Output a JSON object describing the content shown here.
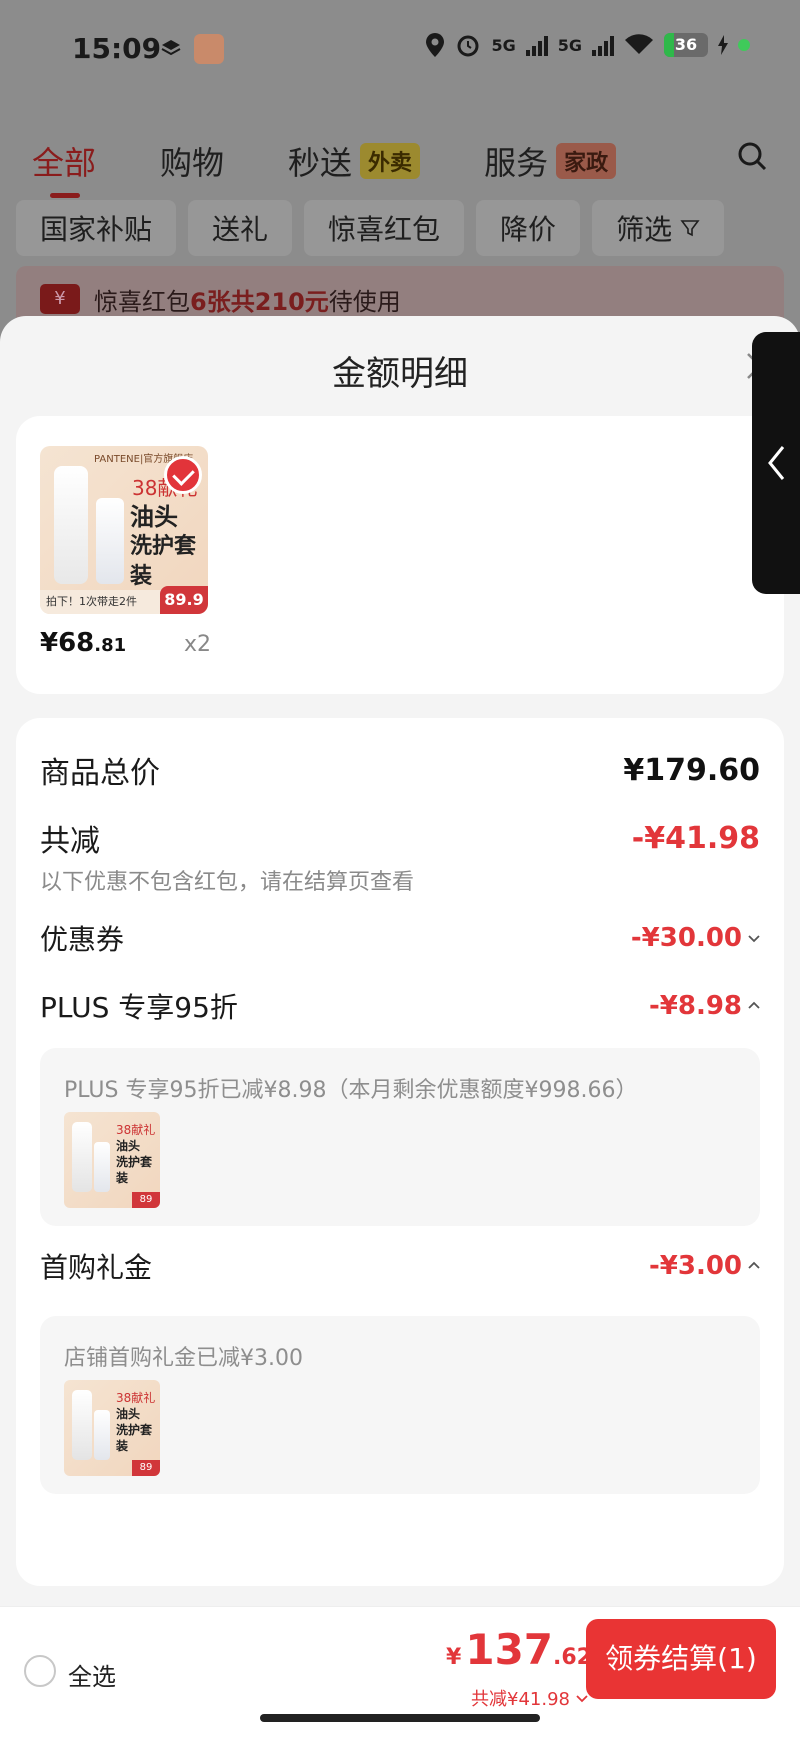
{
  "status_bar": {
    "time": "15:09",
    "battery": "36",
    "network_1": "5G",
    "network_2": "5G"
  },
  "top_tabs": [
    {
      "label": "全部",
      "badge": ""
    },
    {
      "label": "购物",
      "badge": ""
    },
    {
      "label": "秒送",
      "badge": "外卖"
    },
    {
      "label": "服务",
      "badge": "家政"
    }
  ],
  "filters": [
    "国家补贴",
    "送礼",
    "惊喜红包",
    "降价",
    "筛选"
  ],
  "redpack": {
    "icon": "¥",
    "prefix": "惊喜红包",
    "highlight": "6张共210元",
    "suffix": "待使用"
  },
  "sheet": {
    "title": "金额明细"
  },
  "product": {
    "brand": "PANTENE|官方旗舰店",
    "tag": "38献礼",
    "name_line1": "油头",
    "name_line2": "洗护套装",
    "strip": "拍下！1次带走2件",
    "thumb_price": "89.9",
    "price_main": "¥68",
    "price_dec": ".81",
    "qty": "x2"
  },
  "details": {
    "total_label": "商品总价",
    "total_value": "¥179.60",
    "reduce_label": "共减",
    "reduce_value": "-¥41.98",
    "reduce_note": "以下优惠不包含红包，请在结算页查看",
    "coupon_label": "优惠券",
    "coupon_value": "-¥30.00",
    "plus_label": "PLUS 专享95折",
    "plus_value": "-¥8.98",
    "plus_note": "PLUS 专享95折已减¥8.98（本月剩余优惠额度¥998.66）",
    "gift_label": "首购礼金",
    "gift_value": "-¥3.00",
    "gift_note": "店铺首购礼金已减¥3.00"
  },
  "mini_thumb": {
    "tag": "38献礼",
    "line1": "油头",
    "line2": "洗护套装",
    "price": "89"
  },
  "bottom_bar": {
    "select_all": "全选",
    "yen": "¥",
    "price_int": "137",
    "price_dec": ".62",
    "discount": "共减¥41.98",
    "checkout": "领券结算(1)"
  },
  "colors": {
    "accent_red": "#e2363a",
    "button_red": "#e93434",
    "sheet_bg": "#f4f4f4"
  },
  "icons": [
    "layers-icon",
    "app-icon",
    "location-icon",
    "alarm-icon",
    "signal-icon",
    "wifi-icon",
    "battery-icon",
    "search-icon",
    "filter-icon",
    "close-icon",
    "chevron-left-icon",
    "chevron-down-icon",
    "chevron-up-icon",
    "check-icon"
  ]
}
